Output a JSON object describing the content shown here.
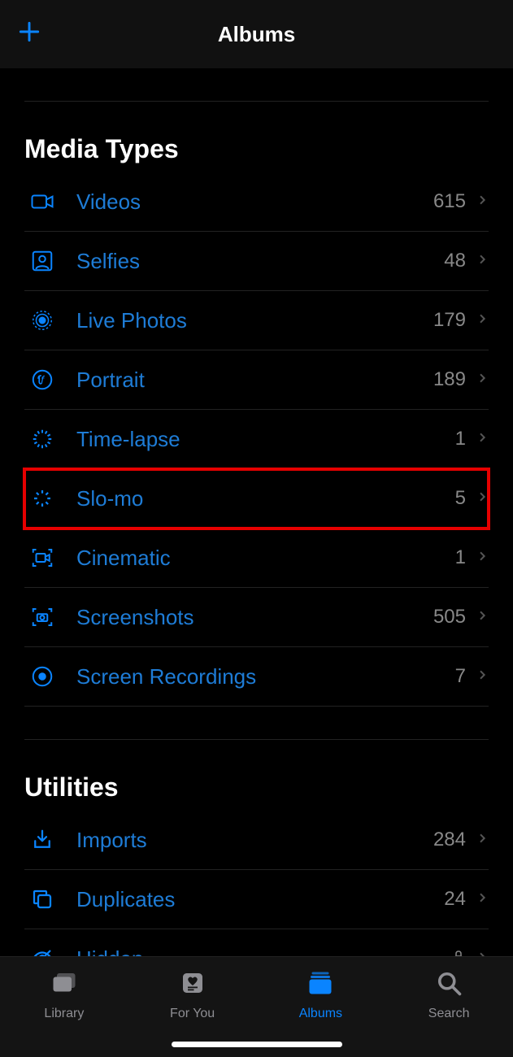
{
  "header": {
    "title": "Albums"
  },
  "sections": {
    "media_types": {
      "title": "Media Types",
      "items": [
        {
          "icon": "video",
          "label": "Videos",
          "count": "615",
          "highlighted": false
        },
        {
          "icon": "selfie",
          "label": "Selfies",
          "count": "48",
          "highlighted": false
        },
        {
          "icon": "live",
          "label": "Live Photos",
          "count": "179",
          "highlighted": false
        },
        {
          "icon": "portrait",
          "label": "Portrait",
          "count": "189",
          "highlighted": false
        },
        {
          "icon": "timelapse",
          "label": "Time-lapse",
          "count": "1",
          "highlighted": false
        },
        {
          "icon": "slomo",
          "label": "Slo-mo",
          "count": "5",
          "highlighted": true
        },
        {
          "icon": "cinematic",
          "label": "Cinematic",
          "count": "1",
          "highlighted": false
        },
        {
          "icon": "screenshot",
          "label": "Screenshots",
          "count": "505",
          "highlighted": false
        },
        {
          "icon": "recording",
          "label": "Screen Recordings",
          "count": "7",
          "highlighted": false
        }
      ]
    },
    "utilities": {
      "title": "Utilities",
      "items": [
        {
          "icon": "imports",
          "label": "Imports",
          "count": "284",
          "locked": false
        },
        {
          "icon": "duplicates",
          "label": "Duplicates",
          "count": "24",
          "locked": false
        },
        {
          "icon": "hidden",
          "label": "Hidden",
          "count": "",
          "locked": true
        }
      ]
    }
  },
  "tabs": [
    {
      "id": "library",
      "label": "Library",
      "active": false
    },
    {
      "id": "foryou",
      "label": "For You",
      "active": false
    },
    {
      "id": "albums",
      "label": "Albums",
      "active": true
    },
    {
      "id": "search",
      "label": "Search",
      "active": false
    }
  ]
}
